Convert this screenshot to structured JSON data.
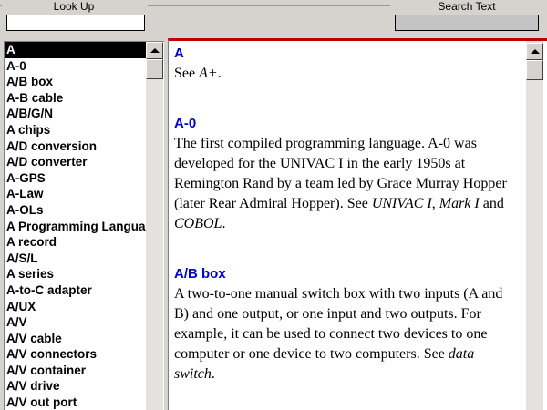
{
  "lookup": {
    "label": "Look Up",
    "value": ""
  },
  "search": {
    "label": "Search Text",
    "value": ""
  },
  "list": {
    "items": [
      "A",
      "A-0",
      "A/B box",
      "A-B cable",
      "A/B/G/N",
      "A chips",
      "A/D conversion",
      "A/D converter",
      "A-GPS",
      "A-Law",
      "A-OLs",
      "A Programming Language",
      "A record",
      "A/S/L",
      "A series",
      "A-to-C adapter",
      "A/UX",
      "A/V",
      "A/V cable",
      "A/V connectors",
      "A/V container",
      "A/V drive",
      "A/V out port"
    ],
    "selected_index": 0
  },
  "entries": [
    {
      "title": "A",
      "text": [
        {
          "t": "See "
        },
        {
          "t": "A+",
          "i": true
        },
        {
          "t": "."
        }
      ]
    },
    {
      "title": "A-0",
      "text": [
        {
          "t": "The first compiled programming language.  A-0 was developed for the UNIVAC I in the early 1950s at Remington Rand by a team led by Grace Murray Hopper (later Rear Admiral Hopper).  See "
        },
        {
          "t": "UNIVAC I",
          "i": true
        },
        {
          "t": ", "
        },
        {
          "t": "Mark I",
          "i": true
        },
        {
          "t": " and "
        },
        {
          "t": "COBOL",
          "i": true
        },
        {
          "t": "."
        }
      ]
    },
    {
      "title": "A/B box",
      "text": [
        {
          "t": "A two-to-one manual switch box with two inputs (A and B) and one output, or one input and two outputs. For example, it can be used to connect two devices to one computer or one device to two computers.  See "
        },
        {
          "t": "data switch",
          "i": true
        },
        {
          "t": "."
        }
      ]
    }
  ],
  "colors": {
    "accent": "#c00000",
    "title": "#0000cc",
    "chrome": "#d6d3ce"
  }
}
